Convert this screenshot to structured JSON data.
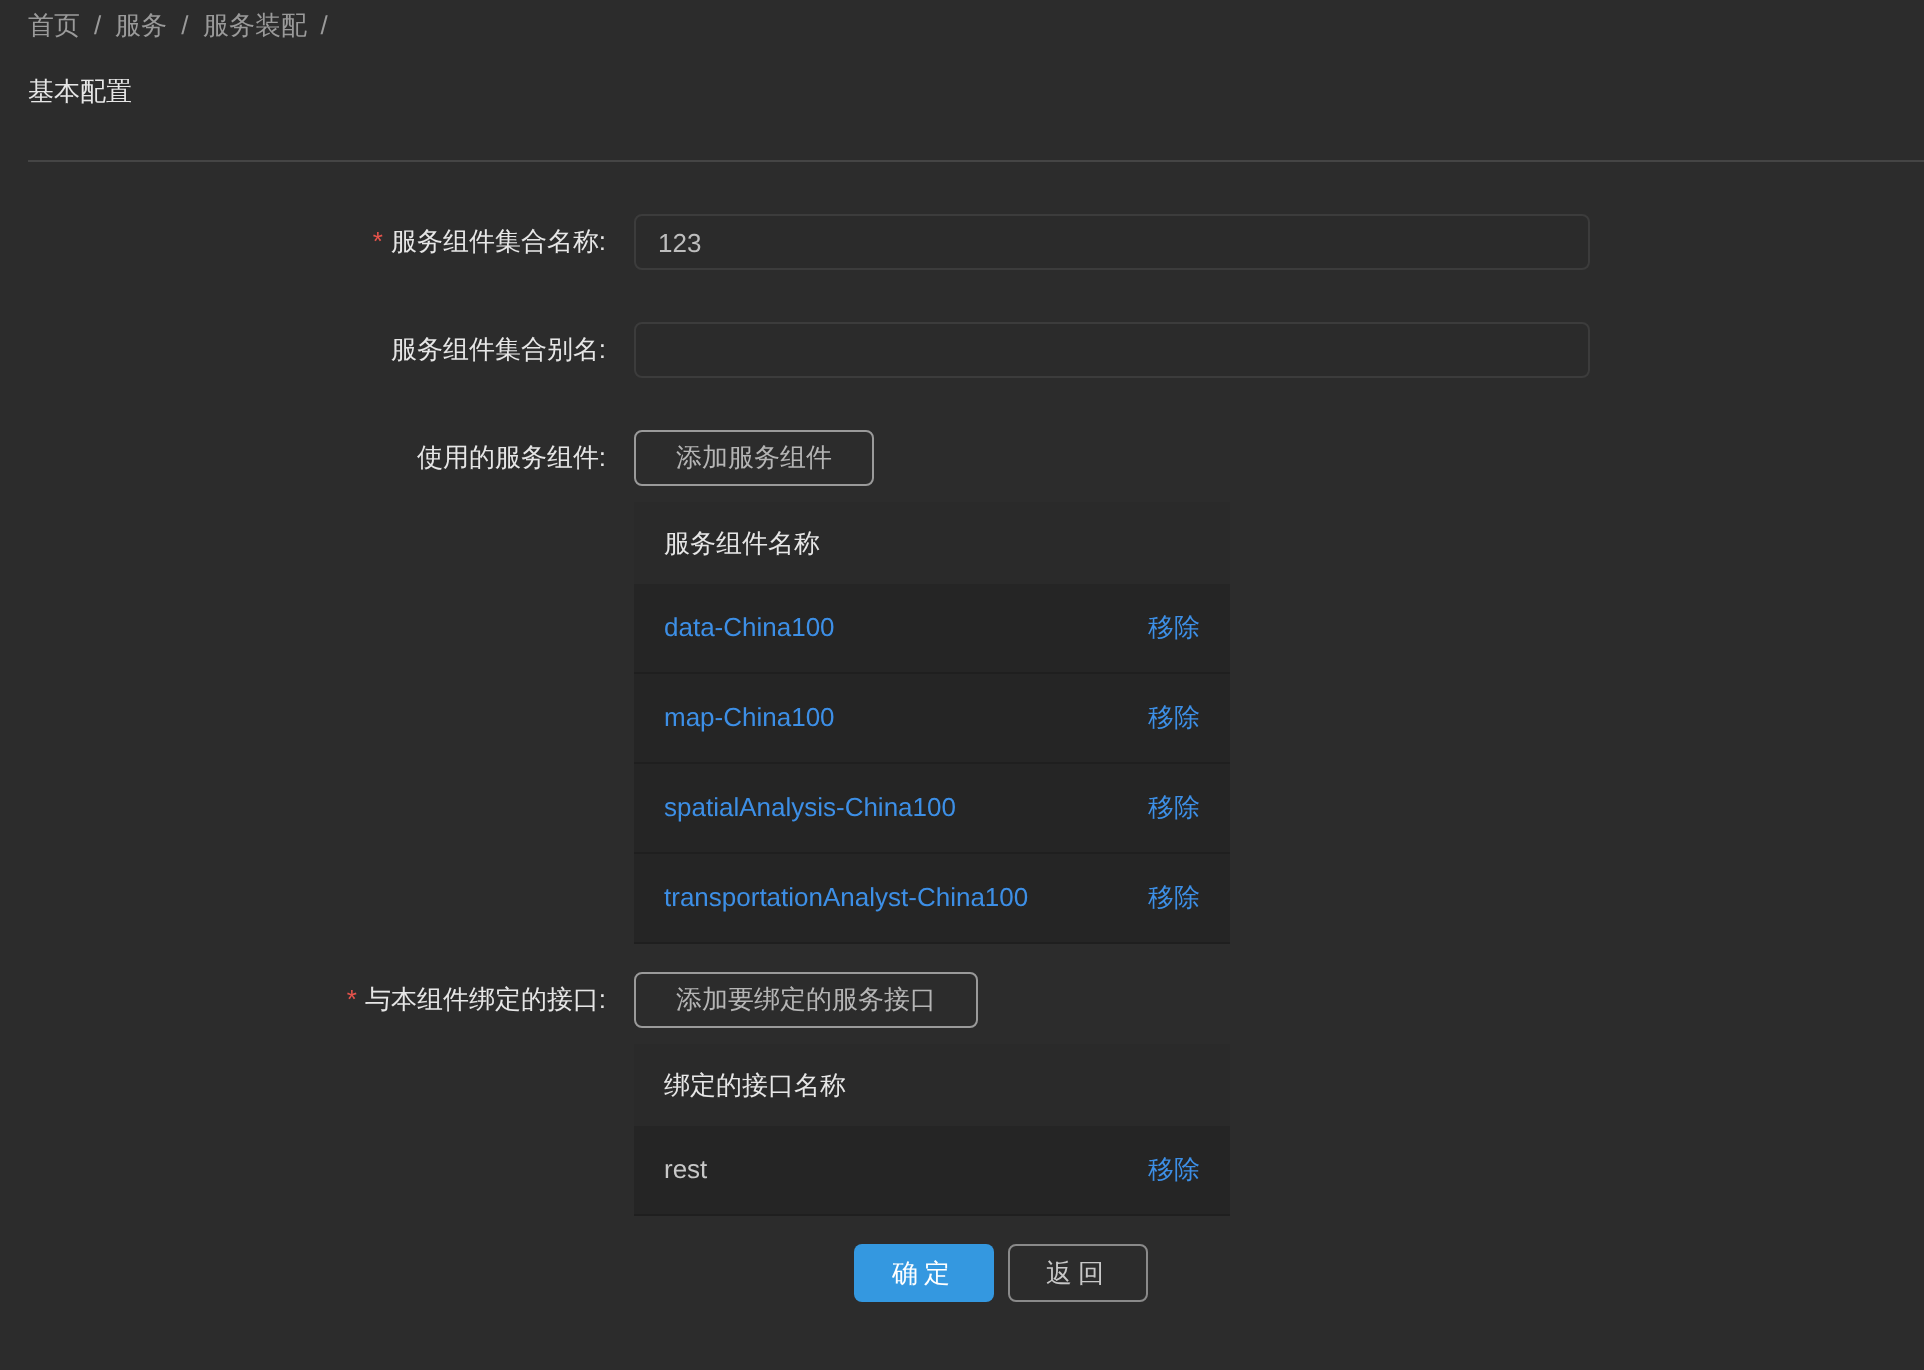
{
  "breadcrumb": [
    {
      "label": "首页"
    },
    {
      "label": "服务"
    },
    {
      "label": "服务装配"
    }
  ],
  "breadcrumb_separator": "/",
  "section_title": "基本配置",
  "form": [
    {
      "kind": "input",
      "label": "服务组件集合名称:",
      "required": true,
      "value": "123"
    },
    {
      "kind": "input",
      "label": "服务组件集合别名:",
      "required": false
    },
    {
      "kind": "table",
      "label": "使用的服务组件:",
      "required": false,
      "button": "添加服务组件",
      "column": "服务组件名称",
      "rows": [
        {
          "name": "data-China100",
          "action": "移除",
          "kind": "link"
        },
        {
          "name": "map-China100",
          "action": "移除",
          "kind": "link"
        },
        {
          "name": "spatialAnalysis-China100",
          "action": "移除",
          "kind": "link"
        },
        {
          "name": "transportationAnalyst-China100",
          "action": "移除",
          "kind": "link"
        }
      ]
    },
    {
      "kind": "table",
      "label": "与本组件绑定的接口:",
      "required": true,
      "button": "添加要绑定的服务接口",
      "column": "绑定的接口名称",
      "rows": [
        {
          "name": "rest",
          "action": "移除",
          "kind": "plain"
        }
      ]
    }
  ],
  "required_mark": "*",
  "actions": [
    {
      "label": "确定",
      "kind": "primary"
    },
    {
      "label": "返回",
      "kind": "default"
    }
  ]
}
